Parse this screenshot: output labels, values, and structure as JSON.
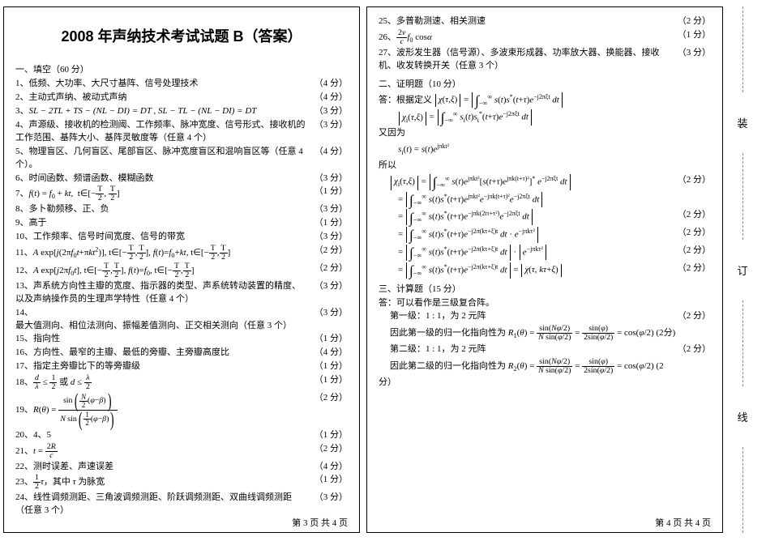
{
  "title": "2008 年声纳技术考试试题 B（答案）",
  "sectionA": {
    "heading": "一、填空（60 分）",
    "items": [
      {
        "n": "1、",
        "t": "低频、大功率、大尺寸基阵、信号处理技术",
        "p": "（4 分）"
      },
      {
        "n": "2、",
        "t": "主动式声纳、被动式声纳",
        "p": "（4 分）"
      },
      {
        "n": "3、",
        "t": "SL − 2TL + TS − (NL − DI) = DT ,  SL − TL − (NL − DI) = DT",
        "p": "（3 分）"
      },
      {
        "n": "4、",
        "t": "声源级、接收机的检测阈、工作频率、脉冲宽度、信号形式、接收机的工作范围、基阵大小、基阵灵敏度等（任意 4 个）",
        "p": "（3 分）"
      },
      {
        "n": "5、",
        "t": "物理盲区、几何盲区、尾部盲区、脉冲宽度盲区和混响盲区等（任意 4 个）。",
        "p": "（4 分）"
      },
      {
        "n": "6、",
        "t": "时间函数、频谱函数、模糊函数",
        "p": "（3 分）"
      },
      {
        "n": "7、",
        "t": "f(t) = f₀ + kt,  t∈[−T/2 , T/2]",
        "p": "（1 分）"
      },
      {
        "n": "8、",
        "t": "多卜勒频移、正、负",
        "p": "（3 分）"
      },
      {
        "n": "9、",
        "t": "高于",
        "p": "（1 分）"
      },
      {
        "n": "10、",
        "t": "工作频率、信号时间宽度、信号的带宽",
        "p": "（3 分）"
      },
      {
        "n": "11、",
        "t": "A exp[ j(2πf₀t + πkt²) ],  t∈[−T/2 , T/2],  f(t) = f₀ + kt,  t∈[−T/2 , T/2]",
        "p": "（2 分）"
      },
      {
        "n": "12、",
        "t": "A exp[ j2πf₀t ],  t∈[−T/2 , T/2],  f(t) = f₀,  t∈[−T/2 , T/2]",
        "p": "（2 分）"
      },
      {
        "n": "13、",
        "t": "声系统方向性主瓣的宽度、指示器的类型、声系统转动装置的精度、以及声纳操作员的生理声学特性（任意 4 个）",
        "p": "（3 分）"
      },
      {
        "n": "14、",
        "t": "最大值测向、相位法测向、振幅差值测向、正交相关测向（任意 3 个）",
        "p": "（3 分）"
      },
      {
        "n": "15、",
        "t": "指向性",
        "p": "（1 分）"
      },
      {
        "n": "16、",
        "t": "方向性、最窄的主瓣、最低的旁瓣、主旁瓣高度比",
        "p": "（4 分）"
      },
      {
        "n": "17、",
        "t": "指定主旁瓣比下的等旁瓣级",
        "p": "（1 分）"
      },
      {
        "n": "18、",
        "t": "d/λ ≤ 1/2 或 d ≤ λ/2",
        "p": "（1 分）"
      },
      {
        "n": "19、",
        "t": "R(θ) = sin( (N/2)(φ−β) ) / ( N sin( (1/2)(φ−β) ) )",
        "p": "（2 分）"
      },
      {
        "n": "20、",
        "t": "4、5",
        "p": "（1 分）"
      },
      {
        "n": "21、",
        "t": "t = 2R / c",
        "p": "（2 分）"
      },
      {
        "n": "22、",
        "t": "测时误差、声速误差",
        "p": "（4 分）"
      },
      {
        "n": "23、",
        "t": "(1/2)τ，其中 τ 为脉宽",
        "p": "（1 分）"
      },
      {
        "n": "24、",
        "t": "线性调频测距、三角波调频测距、阶跃调频测距、双曲线调频测距（任意 3 个）",
        "p": "（3 分）"
      }
    ]
  },
  "rightTop": [
    {
      "n": "25、",
      "t": "多普勒测速、相关测速",
      "p": "（2 分）"
    },
    {
      "n": "26、",
      "t": "(2v/c)·f₀·cosα",
      "p": "（1 分）"
    },
    {
      "n": "27、",
      "t": "波形发生器（信号源）、多波束形成器、功率放大器、换能器、接收机、收发转换开关（任意 3 个）",
      "p": "（3 分）"
    }
  ],
  "sectionB": {
    "heading": "二、证明题（10 分）",
    "ans": "答：根据定义",
    "eq1": "|χ(τ,ξ)| = | ∫₋∞^∞ s(t) s*(t+τ) e^{−j2πξt} dt |",
    "eq2": "|χᵢ(τ,ξ)| = | ∫₋∞^∞ sᵢ(t) sᵢ*(t+τ) e^{−j2πξt} dt |",
    "because": "又因为",
    "eq3": "sᵢ(t) = s(t) e^{ jπkt² }",
    "so": "所以",
    "steps_pts": [
      "（2 分）",
      "（2 分）",
      "（2 分）",
      "（2 分）",
      "（2 分）"
    ],
    "step1": "|χᵢ(τ,ξ)| = | ∫₋∞^∞ s(t)e^{jπkt²}[ s(t+τ)e^{jπk(t+τ)²} ]* e^{−j2πξt} dt |",
    "step2": "= | ∫₋∞^∞ s(t) s*(t+τ) e^{jπkt²} e^{−jπk(t+τ)²} e^{−j2πξt} dt |",
    "step3": "= | ∫₋∞^∞ s(t) s*(t+τ) e^{−jπk(2tτ+τ²)} e^{−j2πξt} dt |",
    "step4": "= | ∫₋∞^∞ s(t) s*(t+τ) e^{−j2π(kτ+ξ)t} dt · e^{−jπkτ²} |",
    "step5": "= | ∫₋∞^∞ s(t) s*(t+τ) e^{−j2π(kτ+ξ)t} dt | · | e^{−jπkτ²} |",
    "step6": "= | ∫₋∞^∞ s(t) s*(t+τ) e^{−j2π(kτ+ξ)t} dt | = | χ(τ, kτ+ξ) |"
  },
  "sectionC": {
    "heading": "三、计算题（15 分）",
    "ans": "答：可以看作是三级复合阵。",
    "l1": "第一级：1 : 1，为 2 元阵",
    "l1eq": "因此第一级的归一化指向性为 R₁(θ) = sin(Nφ/2)/(N sin(φ/2)) = sin(φ)/(2sin(φ/2)) = cos(φ/2)   (2分)",
    "l2": "第二级：1 : 1，为 2 元阵",
    "l2eq": "因此第二级的归一化指向性为 R₂(θ) = sin(Nφ/2)/(N sin(φ/2)) = sin(φ)/(2sin(φ/2)) = cos(φ/2)   (2",
    "tail": "分）",
    "pts": "（2 分）"
  },
  "pgLeft": "第 3 页  共 4 页",
  "pgRight": "第 4 页  共 4 页",
  "binding": [
    "装",
    "订",
    "线"
  ]
}
